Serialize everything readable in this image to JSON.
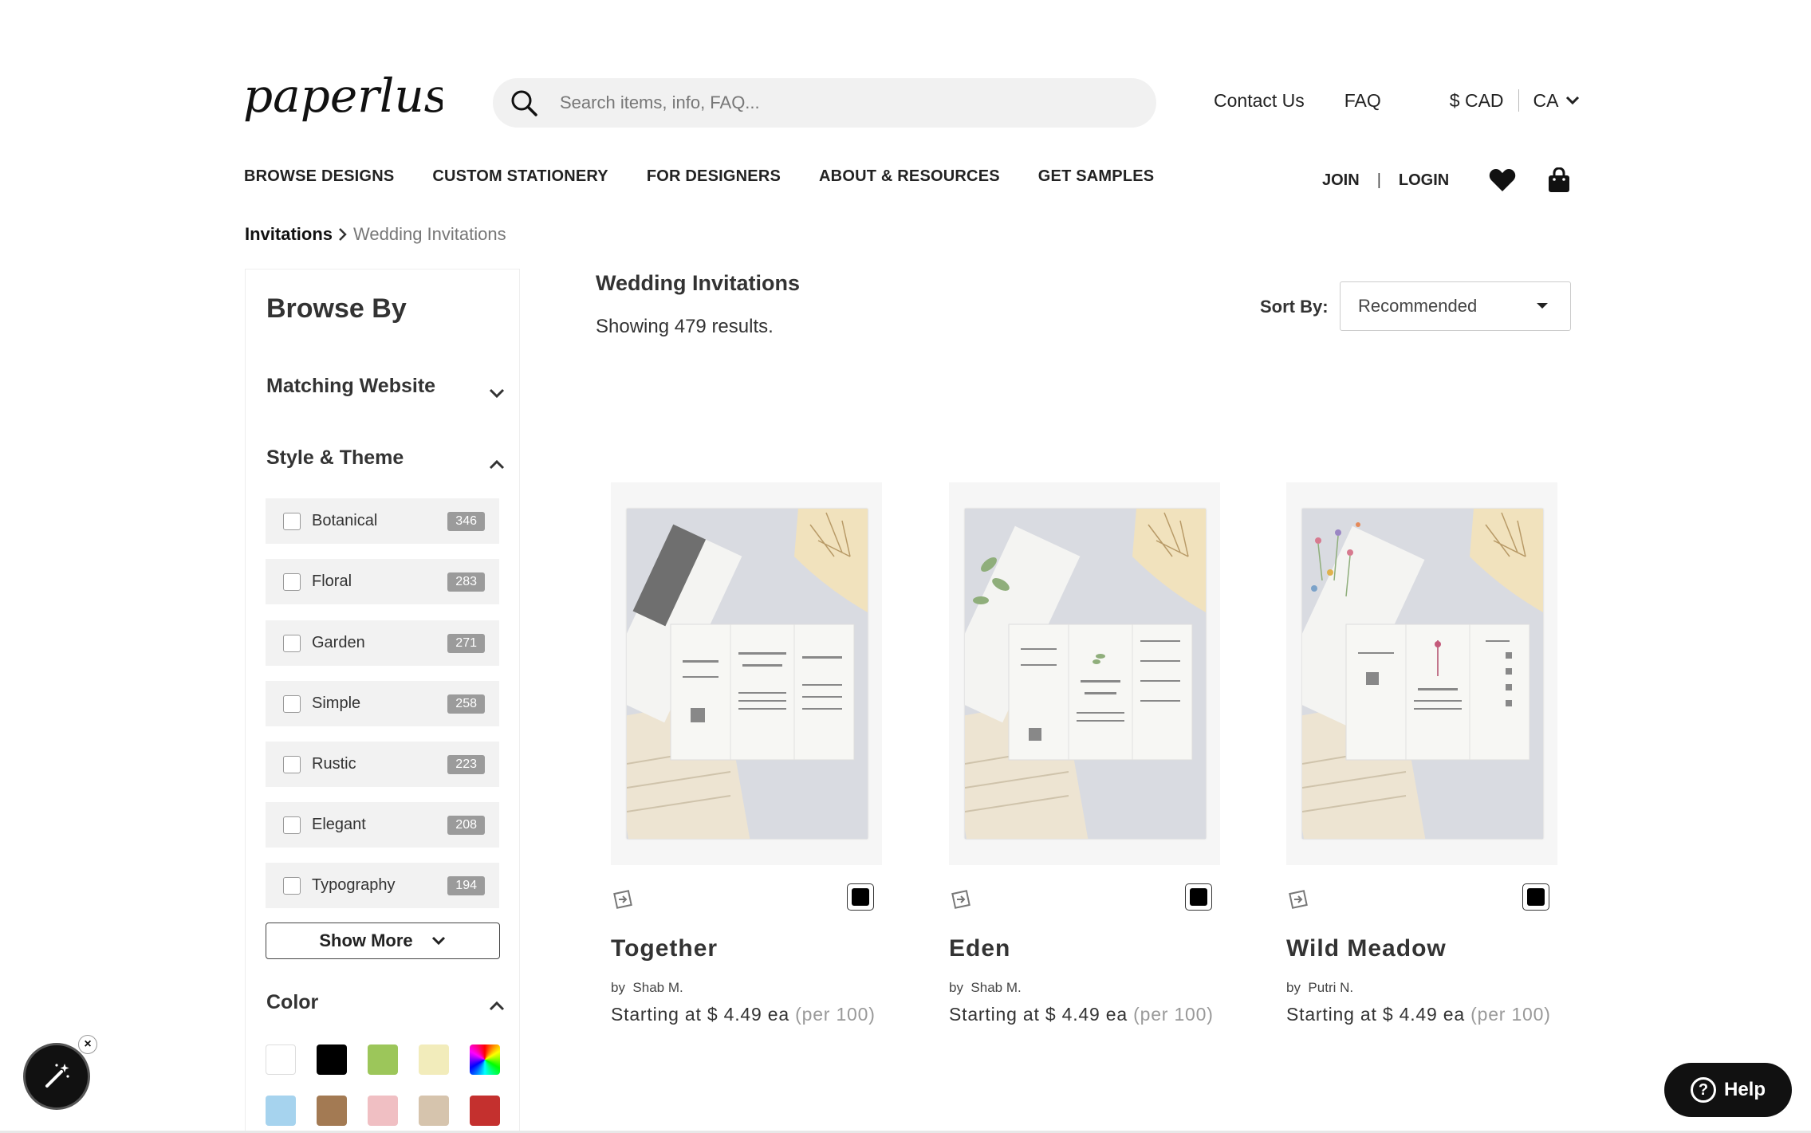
{
  "header": {
    "logo_text": "paperlust",
    "search_placeholder": "Search items, info, FAQ...",
    "contact": "Contact Us",
    "faq": "FAQ",
    "currency": "$ CAD",
    "region": "CA"
  },
  "nav": {
    "items": [
      "BROWSE DESIGNS",
      "CUSTOM STATIONERY",
      "FOR DESIGNERS",
      "ABOUT & RESOURCES",
      "GET SAMPLES"
    ],
    "join": "JOIN",
    "login": "LOGIN",
    "divider": "|"
  },
  "breadcrumb": {
    "parent": "Invitations",
    "current": "Wedding Invitations"
  },
  "sidebar": {
    "title": "Browse By",
    "matching_website": "Matching Website",
    "style_theme": "Style & Theme",
    "filters": [
      {
        "label": "Botanical",
        "count": "346"
      },
      {
        "label": "Floral",
        "count": "283"
      },
      {
        "label": "Garden",
        "count": "271"
      },
      {
        "label": "Simple",
        "count": "258"
      },
      {
        "label": "Rustic",
        "count": "223"
      },
      {
        "label": "Elegant",
        "count": "208"
      },
      {
        "label": "Typography",
        "count": "194"
      }
    ],
    "show_more": "Show More",
    "color": "Color",
    "colors": [
      "#ffffff",
      "#000000",
      "#9cc65a",
      "#f2ecbb",
      "rainbow",
      "#a6d3ee",
      "#a37a53",
      "#f0bfc3",
      "#d6c4ad",
      "#c4302e"
    ]
  },
  "main": {
    "title": "Wedding Invitations",
    "results": "Showing 479 results.",
    "sort_label": "Sort By:",
    "sort_value": "Recommended"
  },
  "products": [
    {
      "name": "Together",
      "by": "by",
      "designer": "Shab M.",
      "price_prefix": "Starting at $ 4.49 ea",
      "per": "(per 100)"
    },
    {
      "name": "Eden",
      "by": "by",
      "designer": "Shab M.",
      "price_prefix": "Starting at $ 4.49 ea",
      "per": "(per 100)"
    },
    {
      "name": "Wild Meadow",
      "by": "by",
      "designer": "Putri N.",
      "price_prefix": "Starting at $ 4.49 ea",
      "per": "(per 100)"
    }
  ],
  "help": {
    "label": "Help"
  },
  "icons": {
    "search": "search-icon",
    "heart": "heart-icon",
    "bag": "shopping-bag-icon",
    "chevron": "chevron-down-icon",
    "magic": "magic-wand-icon",
    "close": "close-icon"
  }
}
